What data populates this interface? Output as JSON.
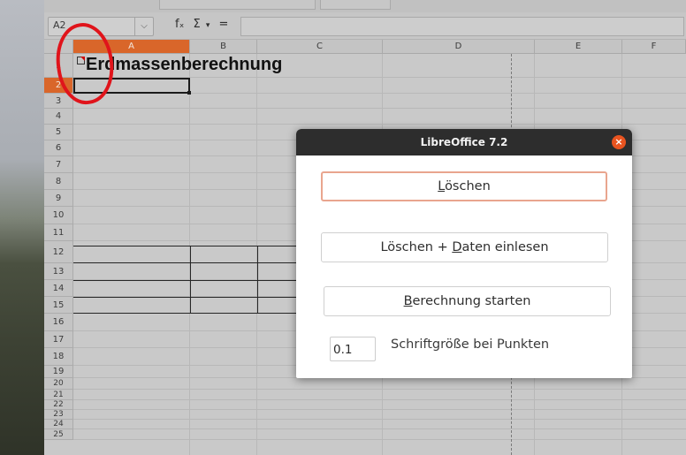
{
  "formula_bar": {
    "name_box": "A2",
    "fx_glyph": "fₓ",
    "sum_glyph": "Σ",
    "dropdown_glyph": "▾",
    "equals_glyph": "="
  },
  "grid": {
    "columns": [
      "A",
      "B",
      "C",
      "D",
      "E",
      "F"
    ],
    "selected_column": "A",
    "rows": [
      "1",
      "2",
      "3",
      "4",
      "5",
      "6",
      "7",
      "8",
      "9",
      "10",
      "11",
      "12",
      "13",
      "14",
      "15",
      "16",
      "17",
      "18",
      "19",
      "20",
      "21",
      "22",
      "23",
      "24",
      "25"
    ],
    "selected_row": "2",
    "cell_A1": "Erdmassenberechnung"
  },
  "dialog": {
    "title": "LibreOffice 7.2",
    "close_glyph": "×",
    "btn_delete": {
      "pre": "",
      "mnemonic": "L",
      "post": "öschen"
    },
    "btn_delete_load": {
      "pre": "Löschen + ",
      "mnemonic": "D",
      "post": "aten einlesen"
    },
    "btn_calc": {
      "pre": "",
      "mnemonic": "B",
      "post": "erechnung starten"
    },
    "font_size_value": "0.1",
    "font_size_label": "Schriftgröße bei Punkten"
  },
  "colors": {
    "selection_accent": "#d9662a",
    "close_button": "#e95420",
    "annotation_circle": "#e0141b"
  }
}
